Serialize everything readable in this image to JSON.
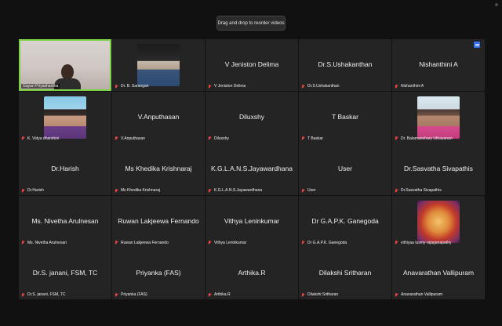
{
  "toast": "Drag and drop to reorder videos",
  "participants": [
    {
      "display": "",
      "label": "Gayan Priyashantha",
      "type": "video",
      "active": true
    },
    {
      "display": "",
      "label": "Dr. B. Sarangan",
      "type": "avatar",
      "avatar": "av-hat"
    },
    {
      "display": "V Jeniston Delima",
      "label": "V Jeniston Delima",
      "type": "name"
    },
    {
      "display": "Dr.S.Ushakanthan",
      "label": "Dr.S.Ushakanthan",
      "type": "name"
    },
    {
      "display": "Nishanthini A",
      "label": "Nishanthini A",
      "type": "name"
    },
    {
      "display": "",
      "label": "K. Vidya dharshini",
      "type": "avatar",
      "avatar": "av-girl"
    },
    {
      "display": "V.Anputhasan",
      "label": "V.Anputhasan",
      "type": "name"
    },
    {
      "display": "Diluxshy",
      "label": "Diluxshy",
      "type": "name"
    },
    {
      "display": "T Baskar",
      "label": "T Baskar",
      "type": "name"
    },
    {
      "display": "",
      "label": "Dr. Balamanohary Uthayanan",
      "type": "avatar",
      "avatar": "av-lady"
    },
    {
      "display": "Dr.Harish",
      "label": "Dr.Harish",
      "type": "name"
    },
    {
      "display": "Ms Khedika Krishnaraj",
      "label": "Ms Khedika Krishnaraj",
      "type": "name"
    },
    {
      "display": "K.G.L.A.N.S.Jayawardhana",
      "label": "K.G.L.A.N.S.Jayawardhana",
      "type": "name"
    },
    {
      "display": "User",
      "label": "User",
      "type": "name"
    },
    {
      "display": "Dr.Sasvatha Sivapathis",
      "label": "Dr.Sasvatha Sivapathis",
      "type": "name"
    },
    {
      "display": "Ms. Nivetha Arulnesan",
      "label": "Ms. Nivetha Arulnesan",
      "type": "name"
    },
    {
      "display": "Ruwan Lakjeewa Fernando",
      "label": "Ruwan Lakjeewa Fernando",
      "type": "name"
    },
    {
      "display": "Vithya Leninkumar",
      "label": "Vithya Leninkumar",
      "type": "name"
    },
    {
      "display": "Dr G.A.P.K. Ganegoda",
      "label": "Dr G.A.P.K. Ganegoda",
      "type": "name"
    },
    {
      "display": "",
      "label": "vithiyaa lusmy rajaganapathy",
      "type": "avatar",
      "avatar": "av-deity"
    },
    {
      "display": "Dr.S. janani, FSM, TC",
      "label": "Dr.S. janani, FSM, TC",
      "type": "name"
    },
    {
      "display": "Priyanka (FAS)",
      "label": "Priyanka (FAS)",
      "type": "name"
    },
    {
      "display": "Arthika.R",
      "label": "Arthika.R",
      "type": "name"
    },
    {
      "display": "Dilakshi Sritharan",
      "label": "Dilakshi Sritharan",
      "type": "name"
    },
    {
      "display": "Anavarathan Vallipuram",
      "label": "Anavarathan Vallipuram",
      "type": "name"
    }
  ],
  "colors": {
    "tile_bg": "#242424",
    "active_border": "#7bd043",
    "muted_mic": "#e8473f",
    "view_button": "#2f6ff0"
  }
}
